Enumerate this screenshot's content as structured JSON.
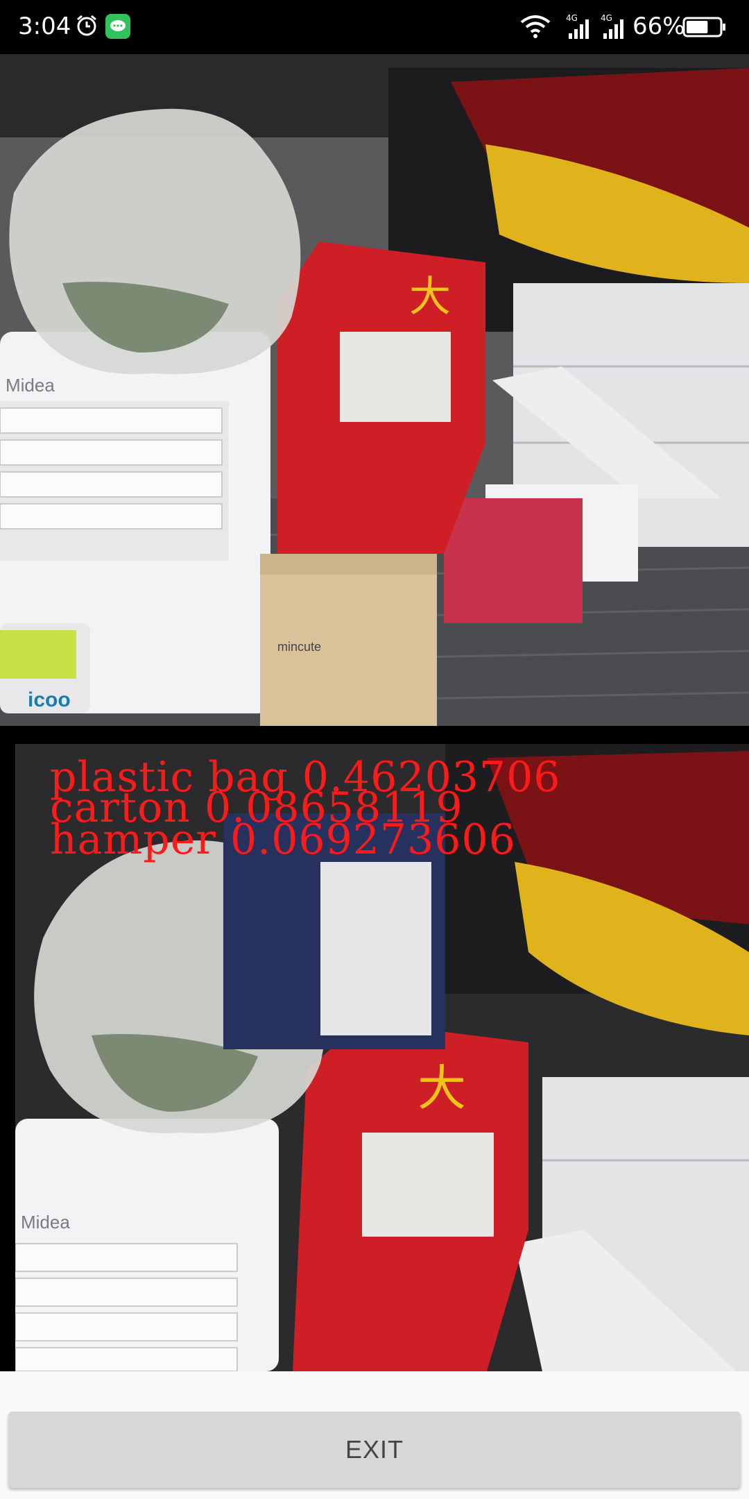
{
  "status_bar": {
    "time": "3:04",
    "battery_percent": "66%",
    "network_1": "4G",
    "network_2": "4G",
    "icons": [
      "alarm-icon",
      "chat-notification-icon",
      "wifi-icon",
      "signal-icon",
      "signal-icon",
      "battery-icon"
    ],
    "battery_level": 0.66
  },
  "camera": {
    "top_frame_label": "",
    "bottom_frame_label": ""
  },
  "detections": [
    {
      "label": "plastic bag 0.46203706"
    },
    {
      "label": "carton 0.08658119"
    },
    {
      "label": "hamper 0.069273606"
    }
  ],
  "scene_text": {
    "appliance_brand": "Midea",
    "box_brand": "mincute",
    "hamper_brand": "icoo"
  },
  "exit_button": {
    "label": "EXIT"
  },
  "colors": {
    "detection_text": "#ff1a1a",
    "button_bg": "#d6d7d7",
    "status_bg": "#000000"
  }
}
